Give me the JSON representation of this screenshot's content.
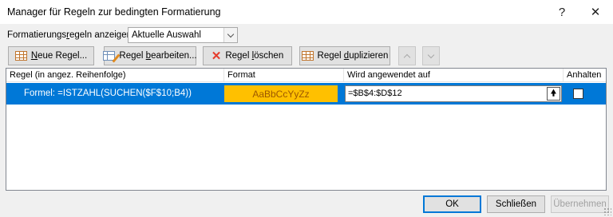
{
  "window": {
    "title": "Manager für Regeln zur bedingten Formatierung",
    "help_label": "?",
    "close_label": "✕"
  },
  "show_rules": {
    "label_before": "Formatierungs",
    "label_underlined": "r",
    "label_after": "egeln anzeigen für:",
    "selected_value": "Aktuelle Auswahl"
  },
  "toolbar": {
    "new_rule_u": "N",
    "new_rule_rest": "eue Regel...",
    "edit_rule_before": "Regel ",
    "edit_rule_u": "b",
    "edit_rule_rest": "earbeiten...",
    "delete_rule_before": "Regel ",
    "delete_rule_u": "l",
    "delete_rule_rest": "öschen",
    "duplicate_rule_before": "Regel ",
    "duplicate_rule_u": "d",
    "duplicate_rule_rest": "uplizieren"
  },
  "table": {
    "columns": {
      "rule": "Regel (in angez. Reihenfolge)",
      "format": "Format",
      "applies_to": "Wird angewendet auf",
      "stop": "Anhalten"
    },
    "rows": [
      {
        "rule": "Formel: =ISTZAHL(SUCHEN($F$10;B4))",
        "format_preview": "AaBbCcYyZz",
        "applies_to": "=$B$4:$D$12",
        "stop_if_true": false
      }
    ]
  },
  "footer": {
    "ok_label": "OK",
    "close_label": "Schließen",
    "apply_label": "Übernehmen"
  },
  "colors": {
    "selection": "#0078d7",
    "format_fill": "#ffc000",
    "format_text": "#9c5700"
  }
}
